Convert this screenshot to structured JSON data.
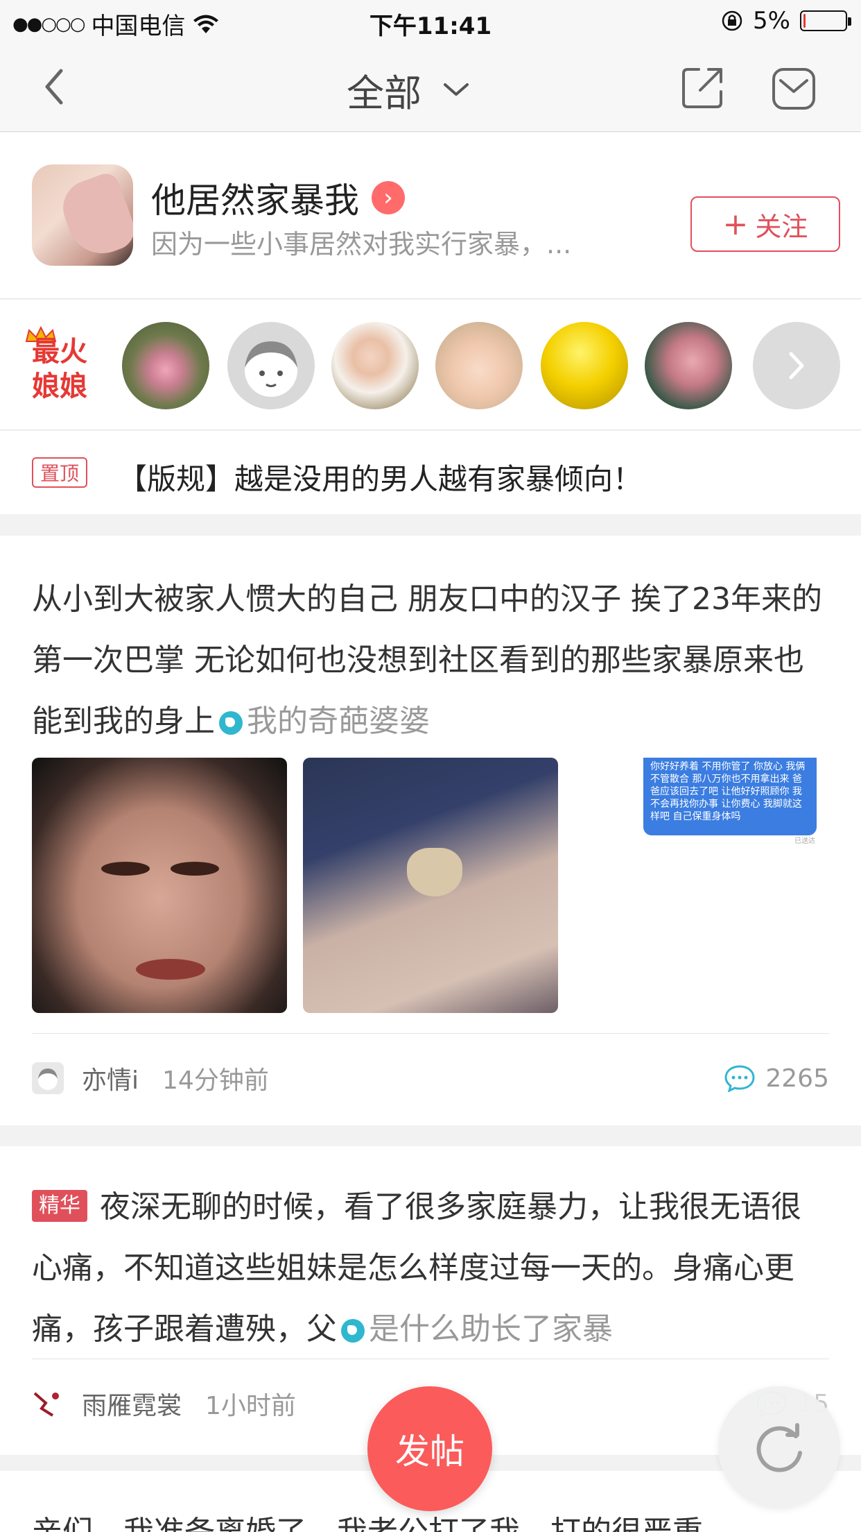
{
  "status": {
    "signal": "●●○○○",
    "carrier": "中国电信",
    "time": "下午11:41",
    "battery": "5%",
    "battery_level": 0.05
  },
  "nav": {
    "title": "全部"
  },
  "group": {
    "name": "他居然家暴我",
    "description": "因为一些小事居然对我实行家暴，...",
    "follow_label": "关注"
  },
  "hot": {
    "badge_line1": "最火",
    "badge_line2": "娘娘"
  },
  "pinned": {
    "tag": "置顶",
    "text": "【版规】越是没用的男人越有家暴倾向！"
  },
  "posts": [
    {
      "title": "从小到大被家人惯大的自己 朋友口中的汉子 挨了23年来的第一次巴掌 无论如何也没想到社区看到的那些家暴原来也能到我的身上",
      "topic": "我的奇葩婆婆",
      "chat_text": "你好好养着 不用你管了 你放心 我俩不管散合 那八万你也不用拿出来 爸爸应该回去了吧 让他好好照顾你 我不会再找你办事 让你费心 我脚就这样吧 自己保重身体吗",
      "chat_meta": "已送达",
      "author": "亦情i",
      "time": "14分钟前",
      "comments": "2265"
    },
    {
      "tag": "精华",
      "title": "夜深无聊的时候，看了很多家庭暴力，让我很无语很心痛，不知道这些姐妹是怎么样度过每一天的。身痛心更痛，孩子跟着遭殃，父",
      "topic": "是什么助长了家暴",
      "author": "雨雁霓裳",
      "time": "1小时前",
      "comments": "15"
    },
    {
      "title": "亲们，我准备离婚了，我老公打了我，打的很严重"
    }
  ],
  "fab": {
    "post_label": "发帖"
  },
  "colors": {
    "accent": "#e0505a",
    "fab": "#fb5b5b",
    "topic": "#2fb7cf"
  }
}
